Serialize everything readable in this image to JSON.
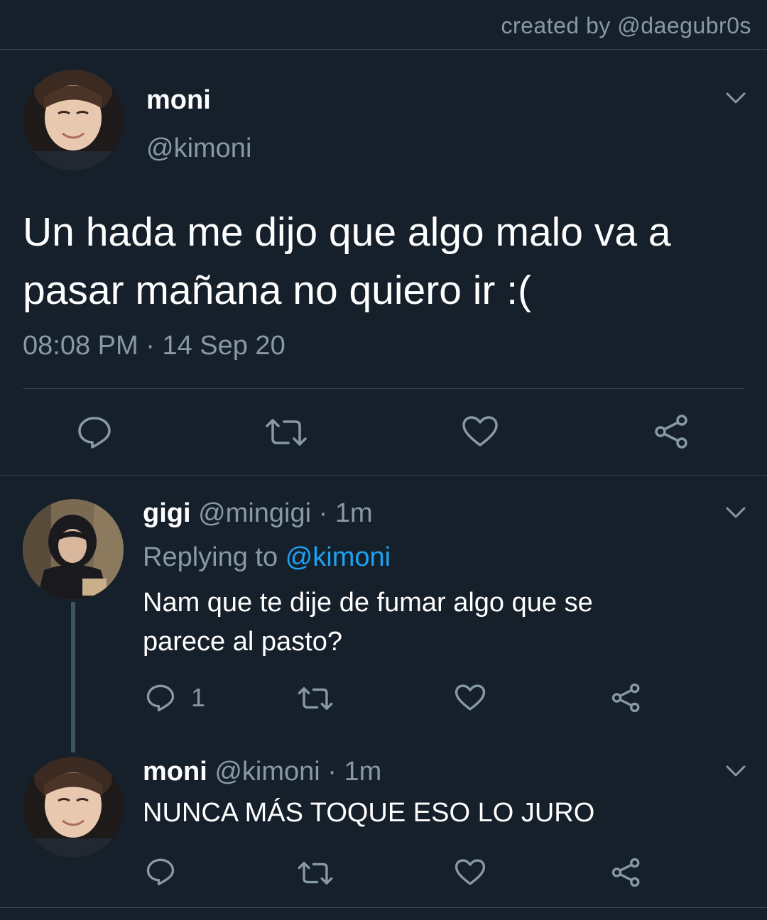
{
  "credit": "created by @daegubr0s",
  "main_tweet": {
    "display_name": "moni",
    "handle": "@kimoni",
    "text_line1": "Un hada me dijo que algo malo va a",
    "text_line2": "pasar mañana no quiero ir :(",
    "time": "08:08 PM",
    "separator": "·",
    "date": "14 Sep 20"
  },
  "reply1": {
    "display_name": "gigi",
    "handle": "@mingigi",
    "separator": "·",
    "age": "1m",
    "replying_prefix": "Replying to",
    "replying_handle": "@kimoni",
    "text_line1": "Nam que te dije de fumar algo que se",
    "text_line2": "parece al pasto?",
    "reply_count": "1"
  },
  "reply2": {
    "display_name": "moni",
    "handle": "@kimoni",
    "separator": "·",
    "age": "1m",
    "text": "NUNCA MÁS TOQUE ESO LO JURO"
  },
  "icons": {
    "reply": "speech-bubble-icon",
    "retweet": "retweet-icon",
    "like": "heart-icon",
    "share": "share-icon",
    "more": "chevron-down-icon"
  },
  "colors": {
    "background": "#15202b",
    "text": "#ffffff",
    "muted": "#8899a6",
    "link": "#1da1f2",
    "divider": "#38444d"
  }
}
